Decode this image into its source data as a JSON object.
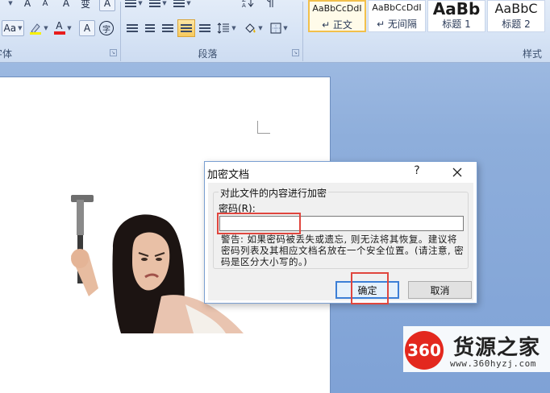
{
  "ribbon": {
    "font_group_label": "字体",
    "paragraph_group_label": "段落",
    "styles_group_label": "样式",
    "styles": [
      {
        "preview": "AaBbCcDdI",
        "name": "↵ 正文",
        "selected": true
      },
      {
        "preview": "AaBbCcDdI",
        "name": "↵ 无间隔",
        "selected": false
      },
      {
        "preview": "AaBb",
        "name": "标题 1",
        "selected": false
      },
      {
        "preview": "AaBbC",
        "name": "标题 2",
        "selected": false
      }
    ],
    "font_buttons": {
      "grow": "A",
      "shrink": "A",
      "clear": "A",
      "change_case": "Aa",
      "char_border": "A",
      "enclose": "字",
      "font_color": "A",
      "phonetic": "变"
    }
  },
  "dialog": {
    "title": "加密文档",
    "help": "?",
    "group_legend": "对此文件的内容进行加密",
    "password_label": "密码(R):",
    "password_value": "",
    "warning": "警告: 如果密码被丢失或遗忘, 则无法将其恢复。建议将密码列表及其相应文档名放在一个安全位置。(请注意, 密码是区分大小写的。)",
    "ok_label": "确定",
    "cancel_label": "取消"
  },
  "watermark": {
    "logo_text": "360",
    "site_name": "货源之家",
    "url": "www.360hyzj.com"
  },
  "colors": {
    "annotation": "#e0463e",
    "accent": "#3c7fd6",
    "logo": "#e3281e"
  }
}
